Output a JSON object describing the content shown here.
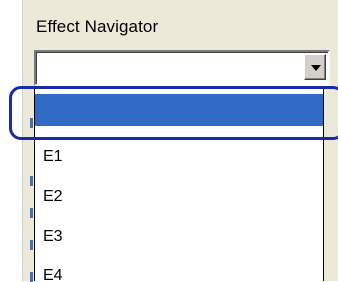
{
  "panel": {
    "title": "Effect Navigator"
  },
  "combo": {
    "value": "",
    "button_icon": "chevron-down-icon"
  },
  "dropdown": {
    "items": [
      {
        "label": "",
        "selected": true
      },
      {
        "label": "E1",
        "selected": false
      },
      {
        "label": "E2",
        "selected": false
      },
      {
        "label": "E3",
        "selected": false
      },
      {
        "label": "E4",
        "selected": false
      }
    ]
  },
  "colors": {
    "selection": "#316ac5",
    "callout": "#1b2aa8",
    "panel": "#ece9d8"
  }
}
